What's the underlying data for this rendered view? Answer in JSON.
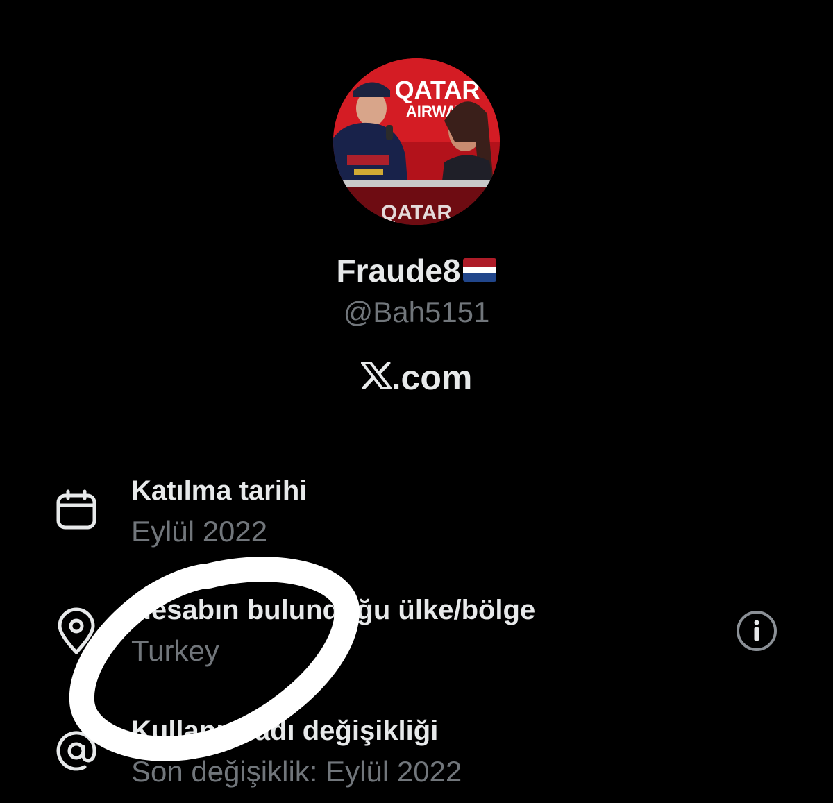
{
  "profile": {
    "display_name": "Fraude8",
    "flag": "netherlands-flag",
    "handle": "@Bah5151",
    "avatar_banner_text_line1": "QATAR",
    "avatar_banner_text_line2": "AIRWAYS",
    "avatar_podium_text": "QATAR"
  },
  "site": {
    "logo": "x-logo",
    "domain": ".com"
  },
  "info": {
    "joined": {
      "icon": "calendar-icon",
      "title": "Katılma tarihi",
      "value": "Eylül 2022"
    },
    "location": {
      "icon": "location-pin-icon",
      "title": "Hesabın bulunduğu ülke/bölge",
      "value": "Turkey",
      "info_icon": "info-circle-icon"
    },
    "username_change": {
      "icon": "at-sign-icon",
      "title": "Kullanıcı adı değişikliği",
      "value": "Son değişiklik: Eylül 2022"
    }
  },
  "colors": {
    "background": "#000000",
    "primary_text": "#e7e9ea",
    "secondary_text": "#71767b",
    "annotation": "#ffffff"
  }
}
